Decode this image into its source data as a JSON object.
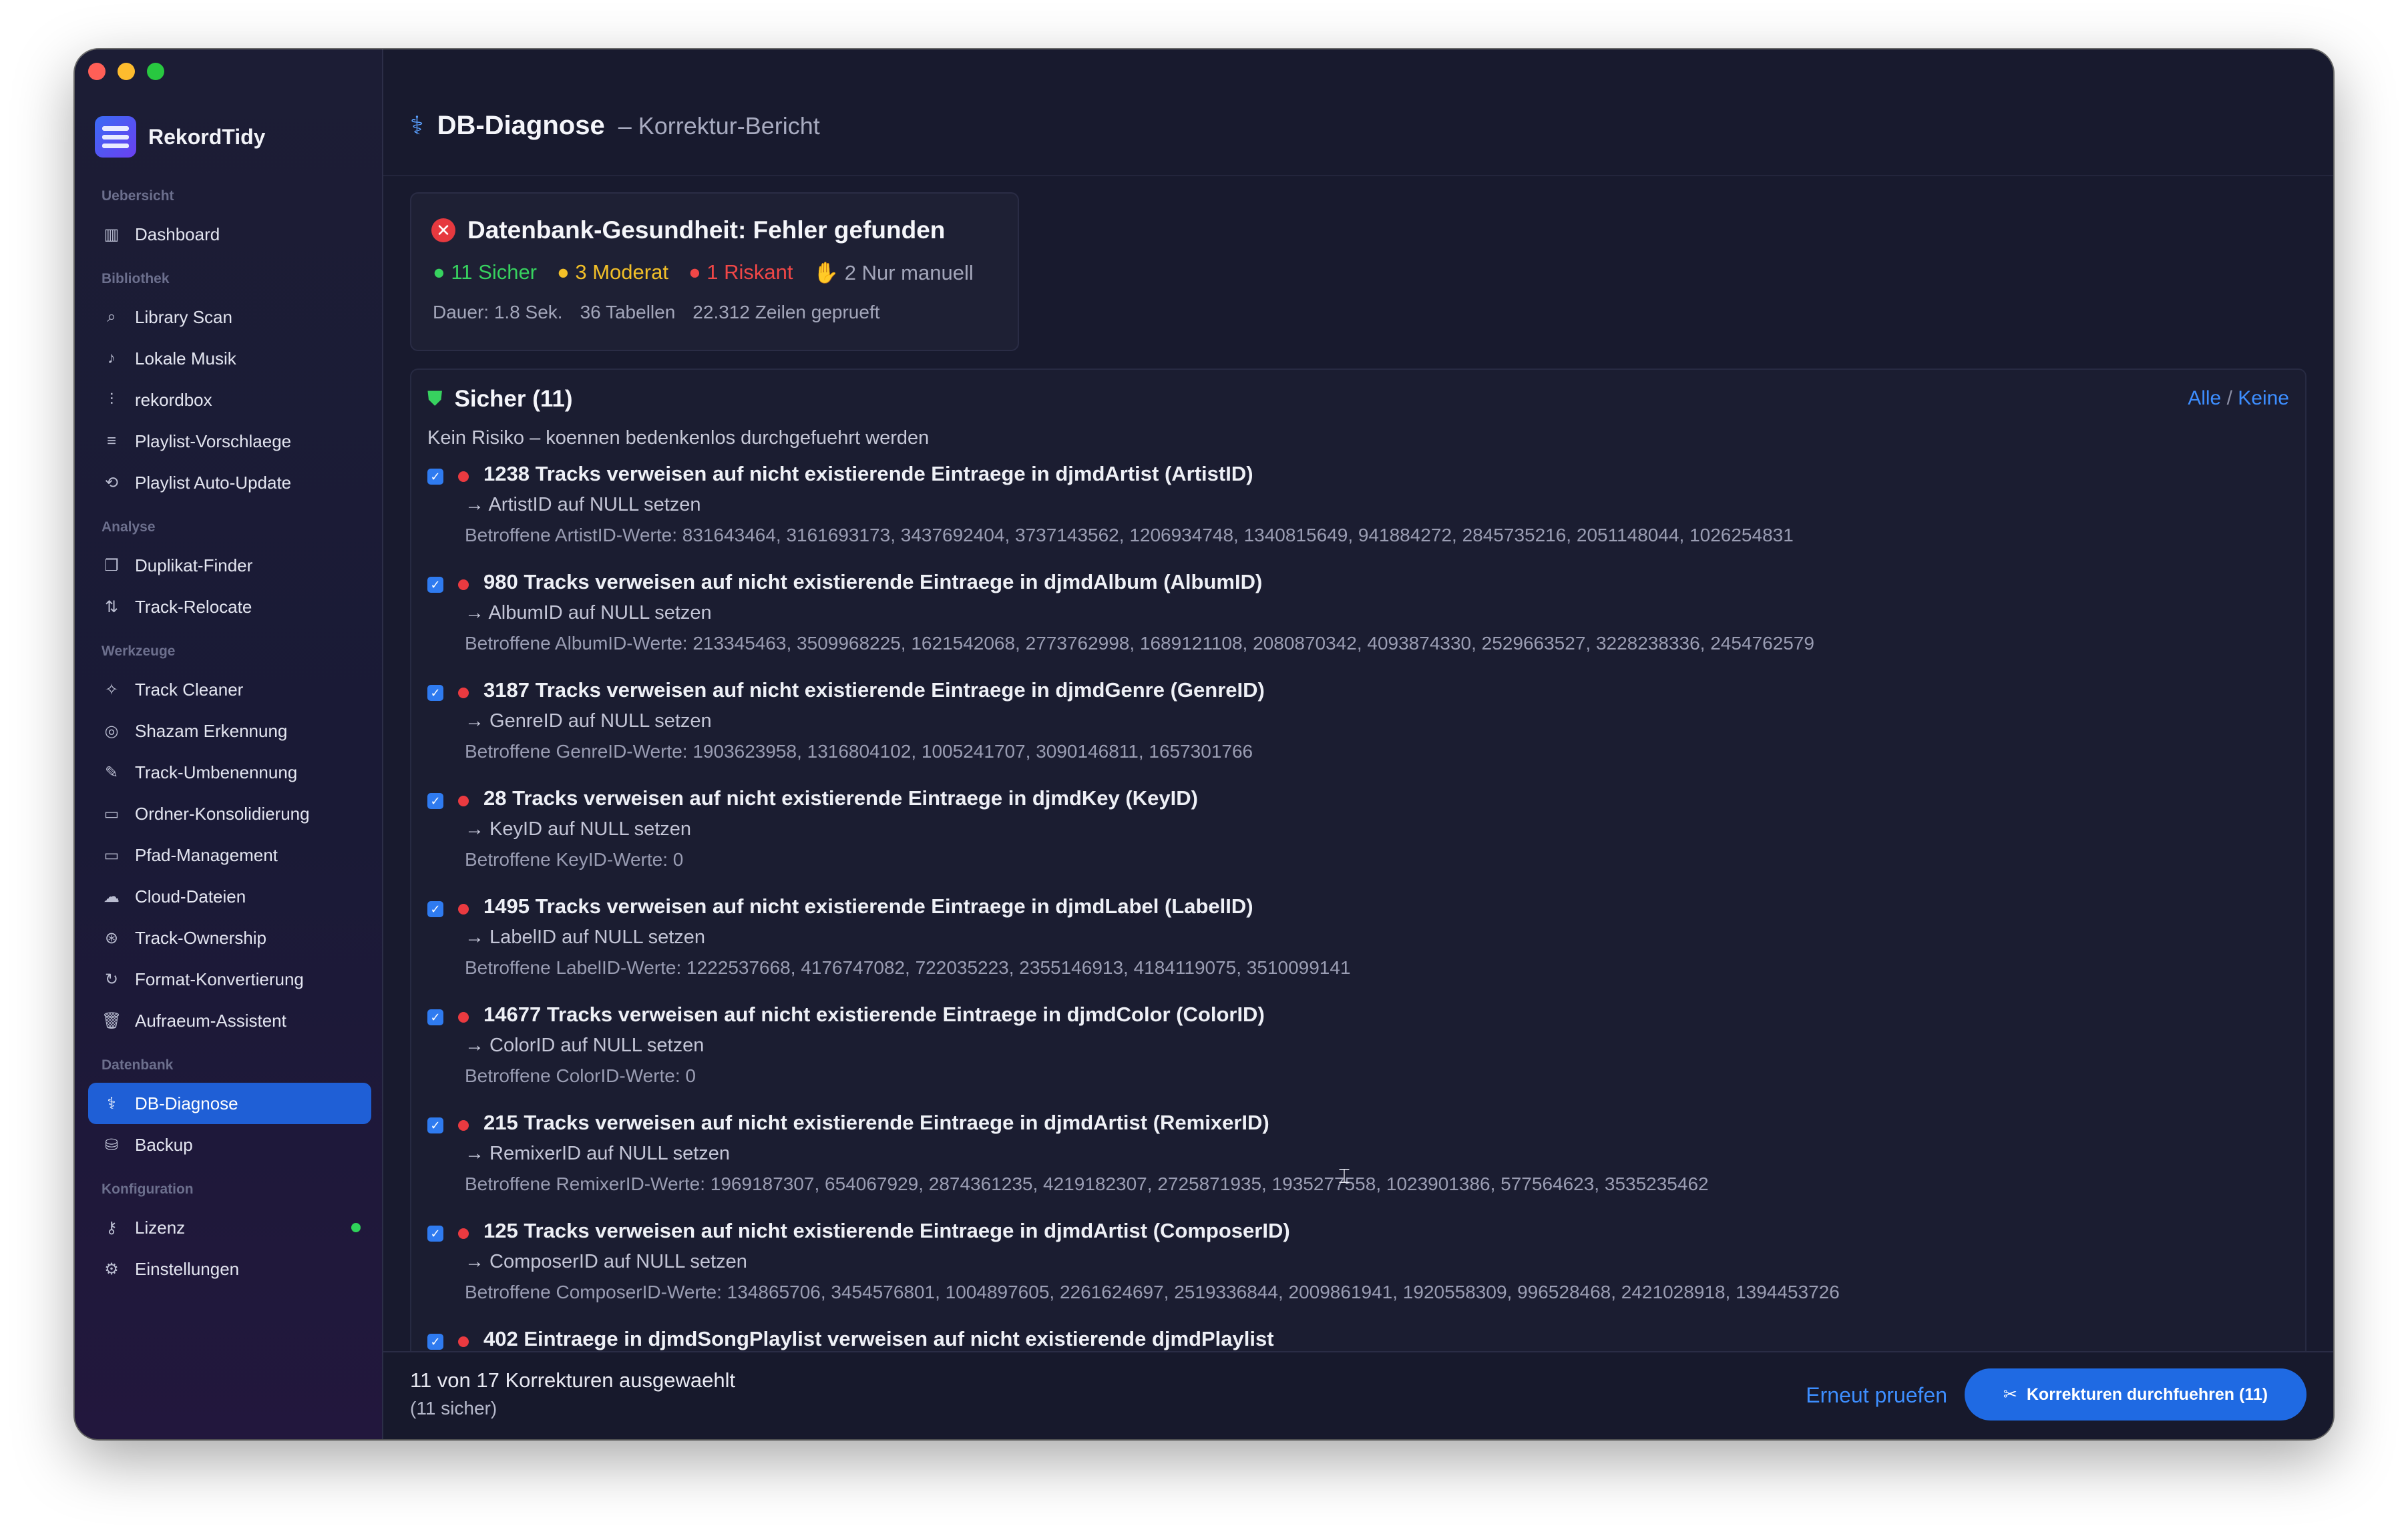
{
  "app": {
    "name": "RekordTidy"
  },
  "sidebar": {
    "sections": [
      {
        "label": "Uebersicht",
        "items": [
          {
            "label": "Dashboard",
            "icon": "chart-bars-icon"
          }
        ]
      },
      {
        "label": "Bibliothek",
        "items": [
          {
            "label": "Library Scan",
            "icon": "search-icon"
          },
          {
            "label": "Lokale Musik",
            "icon": "music-note-icon"
          },
          {
            "label": "rekordbox",
            "icon": "waveform-icon"
          },
          {
            "label": "Playlist-Vorschlaege",
            "icon": "playlist-icon"
          },
          {
            "label": "Playlist Auto-Update",
            "icon": "repeat-icon"
          }
        ]
      },
      {
        "label": "Analyse",
        "items": [
          {
            "label": "Duplikat-Finder",
            "icon": "duplicate-icon"
          },
          {
            "label": "Track-Relocate",
            "icon": "relocate-icon"
          }
        ]
      },
      {
        "label": "Werkzeuge",
        "items": [
          {
            "label": "Track Cleaner",
            "icon": "sparkle-icon"
          },
          {
            "label": "Shazam Erkennung",
            "icon": "shazam-icon"
          },
          {
            "label": "Track-Umbenennung",
            "icon": "pencil-icon"
          },
          {
            "label": "Ordner-Konsolidierung",
            "icon": "folder-icon"
          },
          {
            "label": "Pfad-Management",
            "icon": "folder-path-icon"
          },
          {
            "label": "Cloud-Dateien",
            "icon": "cloud-icon"
          },
          {
            "label": "Track-Ownership",
            "icon": "ownership-icon"
          },
          {
            "label": "Format-Konvertierung",
            "icon": "convert-icon"
          },
          {
            "label": "Aufraeum-Assistent",
            "icon": "trash-icon"
          }
        ]
      },
      {
        "label": "Datenbank",
        "items": [
          {
            "label": "DB-Diagnose",
            "icon": "stethoscope-icon",
            "active": true
          },
          {
            "label": "Backup",
            "icon": "backup-drive-icon"
          }
        ]
      },
      {
        "label": "Konfiguration",
        "items": [
          {
            "label": "Lizenz",
            "icon": "key-icon",
            "status": "green"
          },
          {
            "label": "Einstellungen",
            "icon": "gear-icon"
          }
        ]
      }
    ]
  },
  "header": {
    "title": "DB-Diagnose",
    "subtitle": "– Korrektur-Bericht"
  },
  "health": {
    "title": "Datenbank-Gesundheit: Fehler gefunden",
    "safe": "11 Sicher",
    "moderate": "3 Moderat",
    "risky": "1 Riskant",
    "manual": "2 Nur manuell",
    "duration": "Dauer: 1.8 Sek.",
    "tables": "36 Tabellen",
    "rows": "22.312 Zeilen geprueft"
  },
  "safe_section": {
    "title": "Sicher (11)",
    "subtitle": "Kein Risiko – koennen bedenkenlos durchgefuehrt werden",
    "all_label": "Alle",
    "separator": "/",
    "none_label": "Keine",
    "issues": [
      {
        "title": "1238 Tracks verweisen auf nicht existierende Eintraege in djmdArtist (ArtistID)",
        "action": "→ ArtistID auf NULL setzen",
        "values": "Betroffene ArtistID-Werte: 831643464, 3161693173, 3437692404, 3737143562, 1206934748, 1340815649, 941884272, 2845735216, 2051148044, 1026254831"
      },
      {
        "title": "980 Tracks verweisen auf nicht existierende Eintraege in djmdAlbum (AlbumID)",
        "action": "→ AlbumID auf NULL setzen",
        "values": "Betroffene AlbumID-Werte: 213345463, 3509968225, 1621542068, 2773762998, 1689121108, 2080870342, 4093874330, 2529663527, 3228238336, 2454762579"
      },
      {
        "title": "3187 Tracks verweisen auf nicht existierende Eintraege in djmdGenre (GenreID)",
        "action": "→ GenreID auf NULL setzen",
        "values": "Betroffene GenreID-Werte: 1903623958, 1316804102, 1005241707, 3090146811, 1657301766"
      },
      {
        "title": "28 Tracks verweisen auf nicht existierende Eintraege in djmdKey (KeyID)",
        "action": "→ KeyID auf NULL setzen",
        "values": "Betroffene KeyID-Werte: 0"
      },
      {
        "title": "1495 Tracks verweisen auf nicht existierende Eintraege in djmdLabel (LabelID)",
        "action": "→ LabelID auf NULL setzen",
        "values": "Betroffene LabelID-Werte: 1222537668, 4176747082, 722035223, 2355146913, 4184119075, 3510099141"
      },
      {
        "title": "14677 Tracks verweisen auf nicht existierende Eintraege in djmdColor (ColorID)",
        "action": "→ ColorID auf NULL setzen",
        "values": "Betroffene ColorID-Werte: 0"
      },
      {
        "title": "215 Tracks verweisen auf nicht existierende Eintraege in djmdArtist (RemixerID)",
        "action": "→ RemixerID auf NULL setzen",
        "values": "Betroffene RemixerID-Werte: 1969187307, 654067929, 2874361235, 4219182307, 2725871935, 1935277558, 1023901386, 577564623, 3535235462"
      },
      {
        "title": "125 Tracks verweisen auf nicht existierende Eintraege in djmdArtist (ComposerID)",
        "action": "→ ComposerID auf NULL setzen",
        "values": "Betroffene ComposerID-Werte: 134865706, 3454576801, 1004897605, 2261624697, 2519336844, 2009861941, 1920558309, 996528468, 2421028918, 1394453726"
      },
      {
        "title": "402 Eintraege in djmdSongPlaylist verweisen auf nicht existierende djmdPlaylist",
        "action": "",
        "values": ""
      }
    ]
  },
  "footer": {
    "selection": "11 von 17 Korrekturen ausgewaehlt",
    "selection_sub": "(11 sicher)",
    "recheck": "Erneut pruefen",
    "apply": "Korrekturen durchfuehren (11)"
  },
  "colors": {
    "accent": "#1f6ae3",
    "safe": "#37d25f",
    "moderate": "#f3c028",
    "risky": "#f04747"
  }
}
